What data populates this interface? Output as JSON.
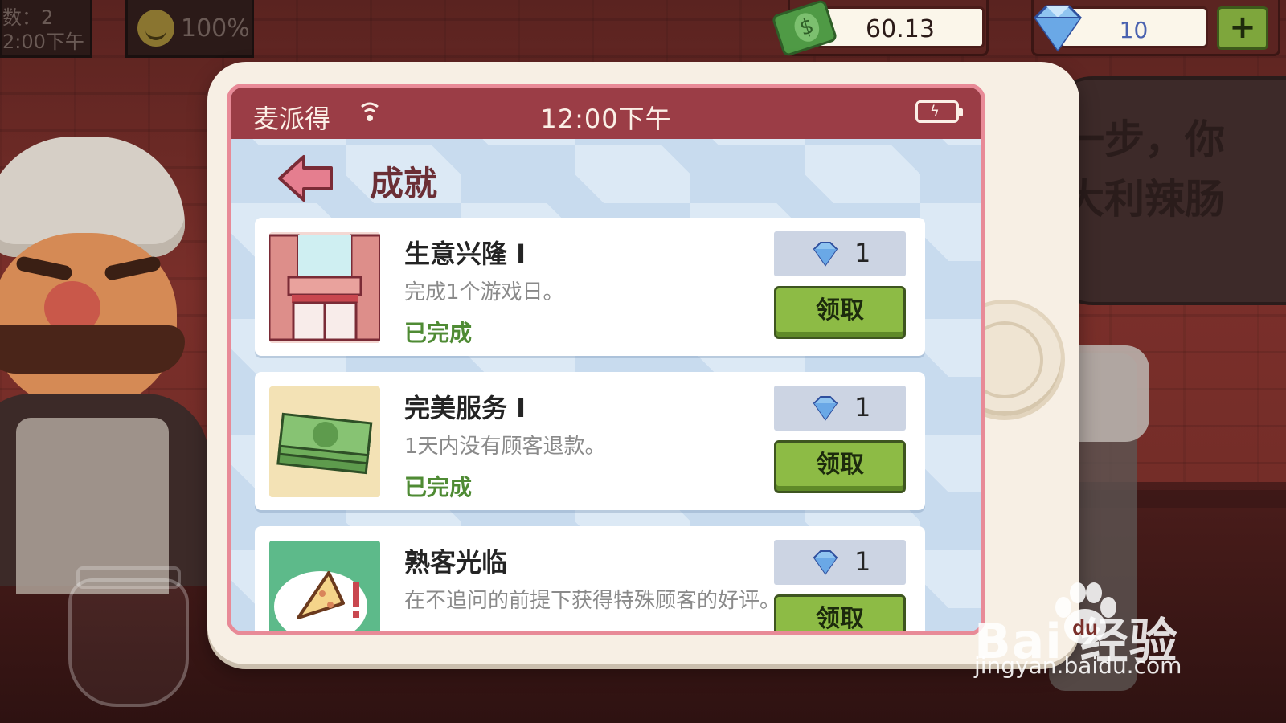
{
  "hud": {
    "day_count_text": "数：2",
    "clock_text": "2:00下午",
    "mood_percent": "100%",
    "money": "60.13",
    "gems": "10",
    "add_label": "+"
  },
  "speech_bubble": {
    "text_line1": "一步，你",
    "text_line2": "大利辣肠"
  },
  "phone": {
    "status_bar": {
      "carrier": "麦派得",
      "time": "12:00下午",
      "battery_icon": "battery-charging-icon",
      "signal_icon": "wifi-icon"
    },
    "page_title": "成就",
    "achievements": [
      {
        "title": "生意兴隆 I",
        "description": "完成1个游戏日。",
        "status": "已完成",
        "reward_amount": "1",
        "reward_icon": "diamond-icon",
        "claim_label": "领取",
        "thumbnail_icon": "storefront-icon"
      },
      {
        "title": "完美服务 I",
        "description": "1天内没有顾客退款。",
        "status": "已完成",
        "reward_amount": "1",
        "reward_icon": "diamond-icon",
        "claim_label": "领取",
        "thumbnail_icon": "cash-stack-icon"
      },
      {
        "title": "熟客光临",
        "description": "在不追问的前提下获得特殊顾客的好评。",
        "status": "",
        "reward_amount": "1",
        "reward_icon": "diamond-icon",
        "claim_label": "领取",
        "thumbnail_icon": "pizza-slice-alert-icon"
      }
    ]
  },
  "watermark": {
    "brand": "Bai  经验",
    "url": "jingyan.baidu.com"
  },
  "colors": {
    "status_bar": "#9b3d46",
    "completed_text": "#4f8b34",
    "claim_button": "#8dbb45",
    "screen_border": "#e88a97"
  }
}
